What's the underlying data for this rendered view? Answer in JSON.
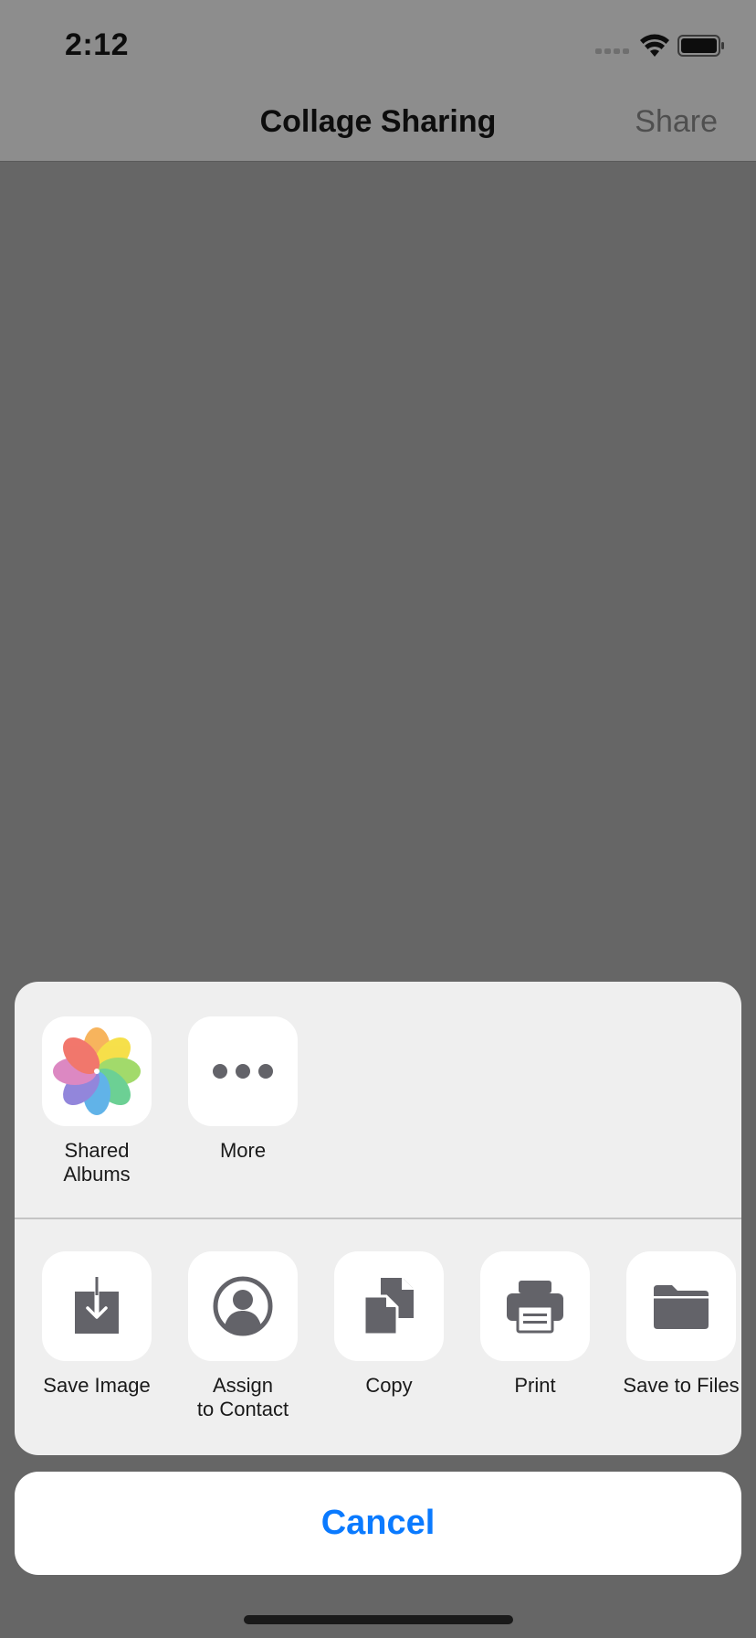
{
  "status": {
    "time": "2:12"
  },
  "nav": {
    "title": "Collage Sharing",
    "share_label": "Share"
  },
  "share_sheet": {
    "apps": [
      {
        "label_line1": "Shared",
        "label_line2": "Albums",
        "icon": "photos-icon"
      },
      {
        "label_line1": "More",
        "label_line2": "",
        "icon": "more-icon"
      }
    ],
    "actions": [
      {
        "label_line1": "Save Image",
        "label_line2": "",
        "icon": "save-image-icon"
      },
      {
        "label_line1": "Assign",
        "label_line2": "to Contact",
        "icon": "contact-icon"
      },
      {
        "label_line1": "Copy",
        "label_line2": "",
        "icon": "copy-icon"
      },
      {
        "label_line1": "Print",
        "label_line2": "",
        "icon": "print-icon"
      },
      {
        "label_line1": "Save to Files",
        "label_line2": "",
        "icon": "folder-icon"
      }
    ]
  },
  "cancel_label": "Cancel",
  "colors": {
    "accent": "#0a7aff",
    "glyph": "#636369",
    "overlay": "#666666"
  }
}
